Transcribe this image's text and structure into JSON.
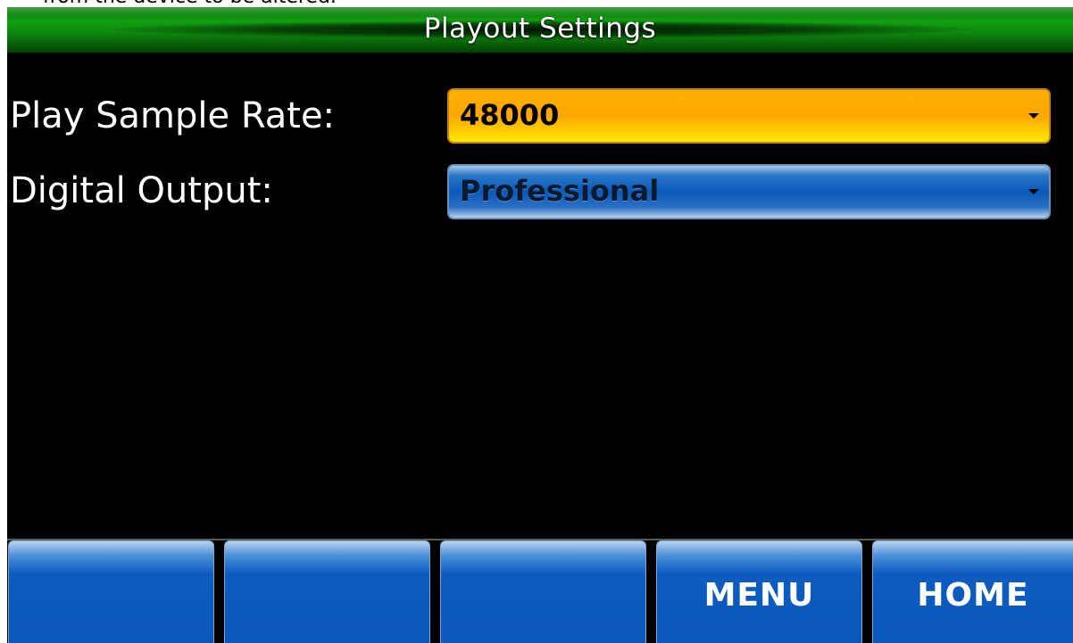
{
  "page_caption_fragment": "from the device to be altered.",
  "window": {
    "title": "Playout Settings"
  },
  "settings": {
    "play_sample_rate": {
      "label": "Play Sample Rate:",
      "value": "48000"
    },
    "digital_output": {
      "label": "Digital Output:",
      "value": "Professional"
    }
  },
  "softkeys": [
    {
      "label": ""
    },
    {
      "label": ""
    },
    {
      "label": ""
    },
    {
      "label": "MENU"
    },
    {
      "label": "HOME"
    }
  ],
  "colors": {
    "title_bar": "#0e8a0e",
    "selected_dropdown": "#ffa600",
    "dropdown": "#0a58b8",
    "softkey": "#0b57bb",
    "background": "#000000"
  }
}
